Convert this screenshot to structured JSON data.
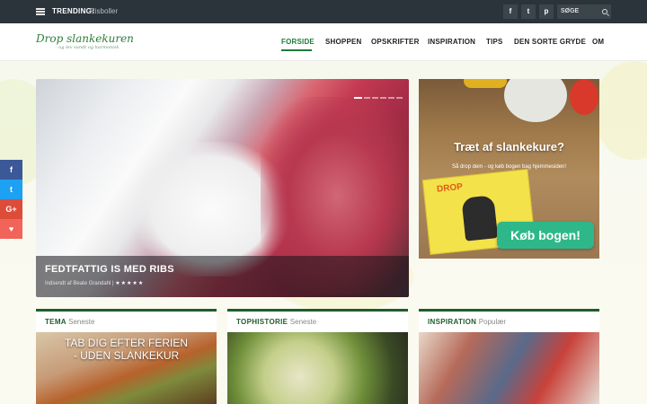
{
  "topbar": {
    "trending_label": "TRENDING:",
    "trending_value": "Risboller",
    "social": [
      "f",
      "t",
      "p"
    ],
    "search_placeholder": "SØGE"
  },
  "header": {
    "logo": "Drop slankekuren",
    "logo_tagline": "- og lev sundt og harmonisk",
    "nav": [
      "FORSIDE",
      "SHOPPEN",
      "OPSKRIFTER",
      "INSPIRATION",
      "TIPS",
      "DEN SORTE GRYDE",
      "OM"
    ],
    "active_nav": "FORSIDE"
  },
  "slider": {
    "title": "FEDTFATTIG IS MED RIBS",
    "meta": "Indsendt af Beate Grandahl |",
    "rating_stars": "★★★★★",
    "rating": 5,
    "dots": 6,
    "active_dot": 0
  },
  "ad": {
    "title": "Træt af slankekure?",
    "subtitle": "Så drop dem - og køb bogen bag hjemmesiden!",
    "book_title": "DROP",
    "button": "Køb bogen!"
  },
  "share": [
    "f",
    "t",
    "G+",
    "♥"
  ],
  "cards": [
    {
      "label": "TEMA",
      "sub": "Seneste",
      "overlay": [
        "TAB DIG EFTER FERIEN",
        "- UDEN SLANKEKUR"
      ]
    },
    {
      "label": "TOPHISTORIE",
      "sub": "Seneste",
      "overlay": []
    },
    {
      "label": "INSPIRATION",
      "sub": "Populær",
      "overlay": []
    }
  ],
  "colors": {
    "topbar": "#2b343b",
    "brand_green": "#1f5d2c",
    "accent_teal": "#2eb88a",
    "facebook": "#3b5998",
    "twitter": "#1da1f2",
    "google": "#dd4b39",
    "love": "#f0645a"
  }
}
